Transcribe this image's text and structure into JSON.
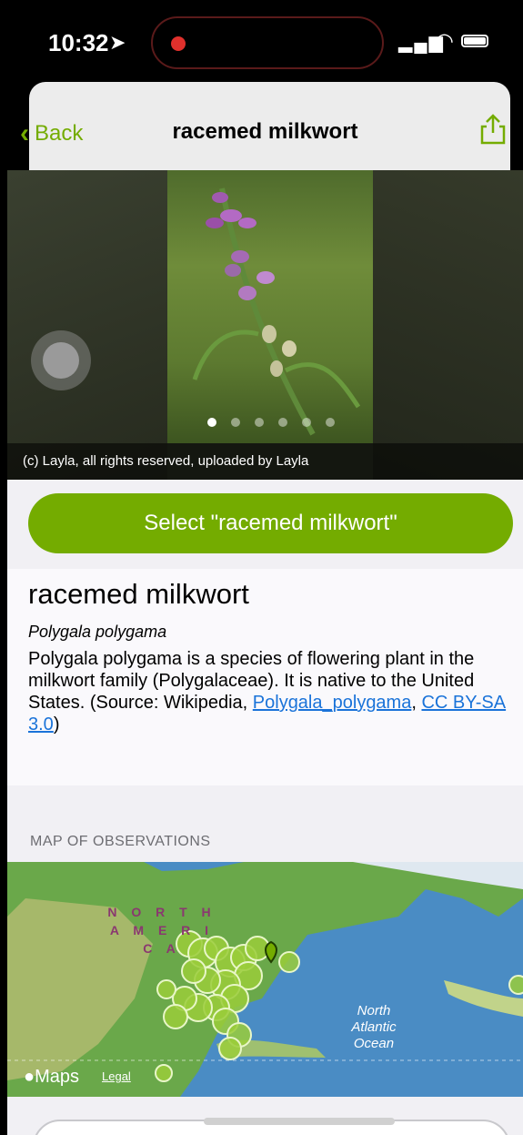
{
  "status_bar": {
    "time": "10:32"
  },
  "nav": {
    "back_label": "Back",
    "title": "racemed milkwort"
  },
  "photo": {
    "attribution": "(c) Layla, all rights reserved, uploaded by Layla",
    "page_count": 6,
    "current_page": 1
  },
  "select_button": {
    "label": "Select \"racemed milkwort\""
  },
  "taxon": {
    "common_name": "racemed milkwort",
    "scientific_name": "Polygala polygama",
    "description_text": "Polygala polygama is a species of flowering plant in the milkwort family (Polygalaceae). It is native to the United States. (Source: Wikipedia, ",
    "wiki_link": "Polygala_polygama",
    "separator": ", ",
    "license_link": "CC BY-SA 3.0",
    "closing": ")"
  },
  "map": {
    "section_title": "MAP OF OBSERVATIONS",
    "continent_label": "N O R T H\nA M E R I C A",
    "ocean_label": "North\nAtlantic\nOcean",
    "brand": "Maps",
    "legal": "Legal"
  },
  "colors": {
    "accent": "#74ac00",
    "link": "#1a73d9"
  }
}
